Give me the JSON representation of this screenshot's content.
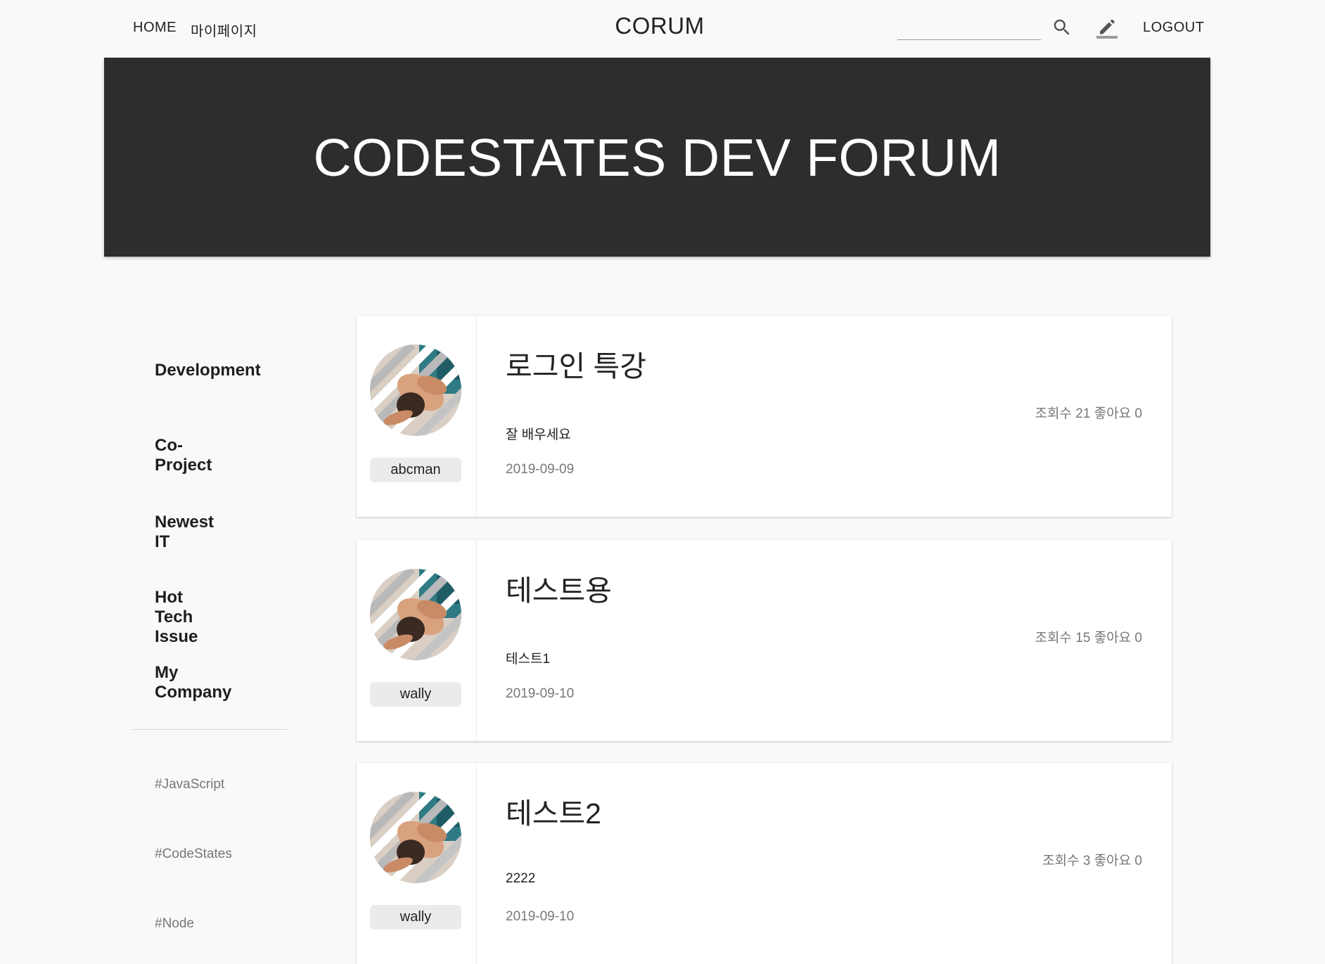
{
  "nav": {
    "home": "HOME",
    "mypage": "마이페이지",
    "brand": "CORUM",
    "search_placeholder": "",
    "search_icon": "search-icon",
    "write_icon": "pencil-icon",
    "logout": "LOGOUT"
  },
  "hero": {
    "title": "CODESTATES DEV FORUM"
  },
  "sidebar": {
    "categories": [
      {
        "label": "Development"
      },
      {
        "label": "Co-Project"
      },
      {
        "label": "Newest IT"
      },
      {
        "label": "Hot Tech Issue"
      },
      {
        "label": "My Company"
      }
    ],
    "tags": [
      {
        "label": "#JavaScript"
      },
      {
        "label": "#CodeStates"
      },
      {
        "label": "#Node"
      }
    ]
  },
  "posts": [
    {
      "title": "로그인 특강",
      "author": "abcman",
      "body": "잘 배우세요",
      "date": "2019-09-09",
      "meta": "조회수 21 좋아요 0"
    },
    {
      "title": "테스트용",
      "author": "wally",
      "body": "테스트1",
      "date": "2019-09-10",
      "meta": "조회수 15 좋아요 0"
    },
    {
      "title": "테스트2",
      "author": "wally",
      "body": "2222",
      "date": "2019-09-10",
      "meta": "조회수 3 좋아요 0"
    }
  ],
  "colors": {
    "background": "#f9f9f9",
    "hero": "#2d2d2d",
    "card": "#ffffff",
    "muted_text": "#777777"
  }
}
